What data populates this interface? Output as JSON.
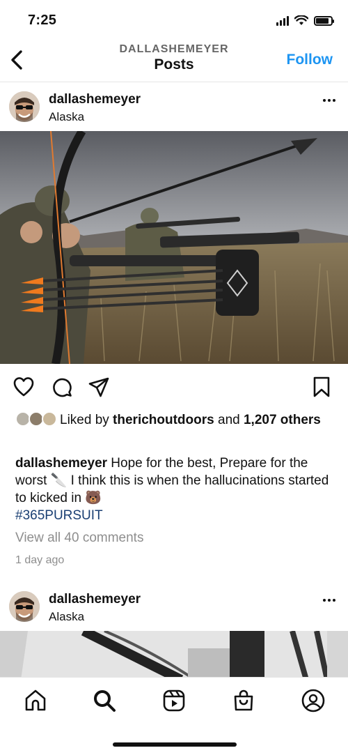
{
  "status_bar": {
    "time": "7:25",
    "icons": [
      "cellular-signal-icon",
      "wifi-icon",
      "battery-icon"
    ],
    "battery_level": 0.85
  },
  "header": {
    "back_icon": "chevron-left-icon",
    "username": "DALLASHEMEYER",
    "title": "Posts",
    "follow_label": "Follow",
    "follow_color": "#1d95f2"
  },
  "posts": [
    {
      "username": "dallashemeyer",
      "location": "Alaska",
      "image_description_icon": "photo",
      "actions": [
        "heart-icon",
        "comment-icon",
        "share-icon",
        "bookmark-icon"
      ],
      "likes": {
        "prefix": "Liked by ",
        "user": "therichoutdoors",
        "middle": " and ",
        "count": "1,207",
        "suffix": " others"
      },
      "caption": {
        "username": "dallashemeyer",
        "text": " Hope for the best, Prepare for the worst 🔪 I think this is when the hallucinations started to kicked in 🐻",
        "hashtag": "#365PURSUIT"
      },
      "view_comments": "View all 40 comments",
      "time_ago": "1 day ago"
    },
    {
      "username": "dallashemeyer",
      "location": "Alaska"
    }
  ],
  "bottom_nav": {
    "items": [
      "home-icon",
      "search-icon",
      "reels-icon",
      "shop-icon",
      "profile-icon"
    ],
    "active": "search-icon"
  }
}
